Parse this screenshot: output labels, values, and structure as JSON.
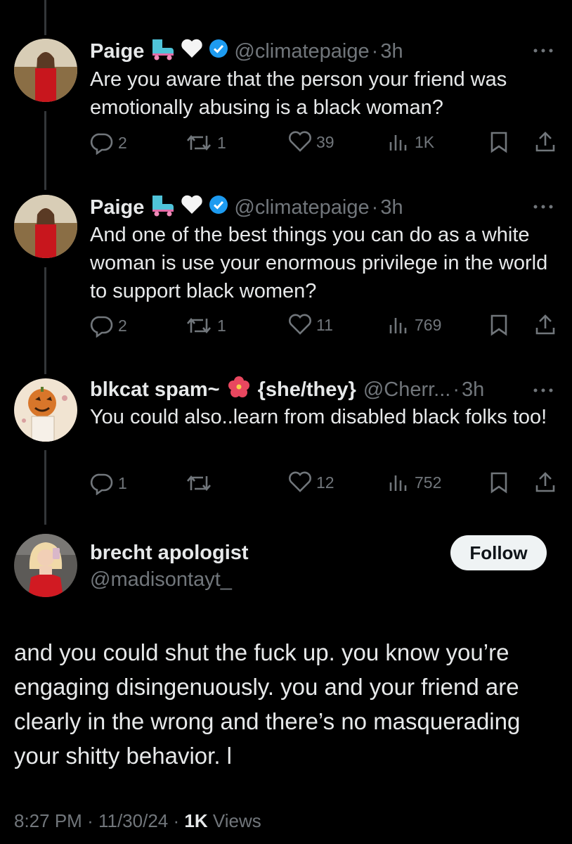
{
  "thread": [
    {
      "name": "Paige",
      "handle": "@climatepaige",
      "time": "3h",
      "text": "Are you aware that the person your friend was emotionally abusing is a black woman?",
      "replies": "2",
      "reposts": "1",
      "likes": "39",
      "views": "1K"
    },
    {
      "name": "Paige",
      "handle": "@climatepaige",
      "time": "3h",
      "text": "And one of the best things you can do as a white woman is use your enormous privilege in the world to support black women?",
      "replies": "2",
      "reposts": "1",
      "likes": "11",
      "views": "769"
    },
    {
      "name": "blkcat spam~",
      "pronouns": "{she/they}",
      "handle": "@Cherr...",
      "time": "3h",
      "text": "You could also..learn from disabled black folks too!",
      "replies": "1",
      "reposts": "",
      "likes": "12",
      "views": "752"
    }
  ],
  "main_tweet": {
    "name": "brecht apologist",
    "handle": "@madisontayt_",
    "follow_label": "Follow",
    "text": "and you could shut the fuck up. you know you’re engaging disingenuously. you and your friend are clearly in the wrong and there’s no masquerading your shitty behavior. l",
    "time": "8:27 PM",
    "date": "11/30/24",
    "views_count": "1K",
    "views_label": "Views",
    "sep": "·"
  },
  "colors": {
    "background": "#000000",
    "text": "#e7e9ea",
    "muted": "#71767b",
    "verified": "#1d9bf0",
    "thread_line": "#333639"
  }
}
